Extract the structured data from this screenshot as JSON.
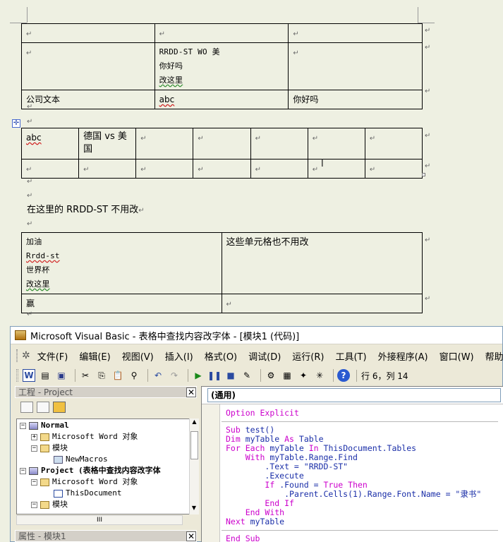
{
  "document": {
    "table1": {
      "row2_col1_lines": [
        "RRDD-ST WO 美",
        "你好吗",
        "改这里"
      ],
      "row3": [
        "公司文本",
        "abc",
        "你好吗"
      ]
    },
    "table2": {
      "row1": [
        "abc",
        "德国 vs 美国"
      ]
    },
    "paragraph": "在这里的 RRDD-ST 不用改",
    "table3": {
      "cell_left_lines": [
        "加油",
        "Rrdd-st",
        "世界杯",
        "改这里"
      ],
      "cell_right": "这些单元格也不用改",
      "bottom_left": "赢"
    }
  },
  "vbe": {
    "title": "Microsoft Visual Basic - 表格中查找内容改字体 - [模块1 (代码)]",
    "menu": [
      "文件(F)",
      "编辑(E)",
      "视图(V)",
      "插入(I)",
      "格式(O)",
      "调试(D)",
      "运行(R)",
      "工具(T)",
      "外接程序(A)",
      "窗口(W)",
      "帮助(H)"
    ],
    "status": "行 6，列 14",
    "project_pane": {
      "title": "工程 - Project",
      "tree": {
        "normal": "Normal",
        "word_objects": "Microsoft Word 对象",
        "modules": "模块",
        "newmacros": "NewMacros",
        "project": "Project (表格中查找内容改字体",
        "word_objects2": "Microsoft Word 对象",
        "thisdocument": "ThisDocument",
        "modules2": "模块"
      },
      "scroll_label": "III"
    },
    "properties_title": "属性 - 模块1",
    "code": {
      "object_box": "(通用)",
      "option_kw": "Option",
      "option_id": "Explicit",
      "sub_kw": "Sub",
      "sub_name": "test()",
      "dim_kw": "Dim",
      "dim_var": "myTable",
      "as_kw": "As",
      "dim_type": "Table",
      "for_kw": "For Each",
      "for_var": "myTable",
      "in_kw": "In",
      "for_coll": "ThisDocument.Tables",
      "with_kw": "With",
      "with_obj": "myTable.Range.Find",
      "text_line": ".Text = \"RRDD-ST\"",
      "execute_line": ".Execute",
      "if_kw": "If",
      "if_cond": ".Found =",
      "true_kw": "True",
      "then_kw": "Then",
      "font_line": ".Parent.Cells(1).Range.Font.Name = \"隶书\"",
      "endif": "End If",
      "endwith": "End With",
      "next_kw": "Next",
      "next_var": "myTable",
      "endsub": "End Sub"
    }
  }
}
